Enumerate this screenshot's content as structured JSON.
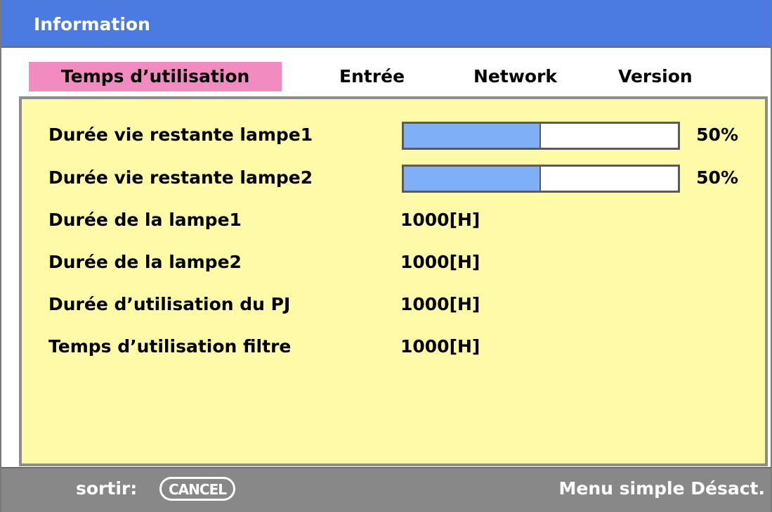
{
  "window": {
    "title": "Information"
  },
  "tabs": [
    {
      "label": "Temps d’utilisation",
      "active": true
    },
    {
      "label": "Entrée",
      "active": false
    },
    {
      "label": "Network",
      "active": false
    },
    {
      "label": "Version",
      "active": false
    }
  ],
  "rows": [
    {
      "label": "Durée vie restante lampe1",
      "percent": "50%",
      "fraction": 0.5
    },
    {
      "label": "Durée vie restante lampe2",
      "percent": "50%",
      "fraction": 0.5
    },
    {
      "label": "Durée de la lampe1",
      "value": "1000[H]"
    },
    {
      "label": "Durée de la lampe2",
      "value": "1000[H]"
    },
    {
      "label": "Durée d’utilisation du PJ",
      "value": "1000[H]"
    },
    {
      "label": "Temps d’utilisation filtre",
      "value": "1000[H]"
    }
  ],
  "statusbar": {
    "exit_label": "sortir:",
    "cancel_key": "CANCEL",
    "menu_mode": "Menu simple Désact."
  },
  "colors": {
    "titlebar": "#4b7be0",
    "active_tab": "#f18bc0",
    "panel": "#fffaa8",
    "bar_fill": "#7fb0f7",
    "statusbar": "#888888"
  }
}
